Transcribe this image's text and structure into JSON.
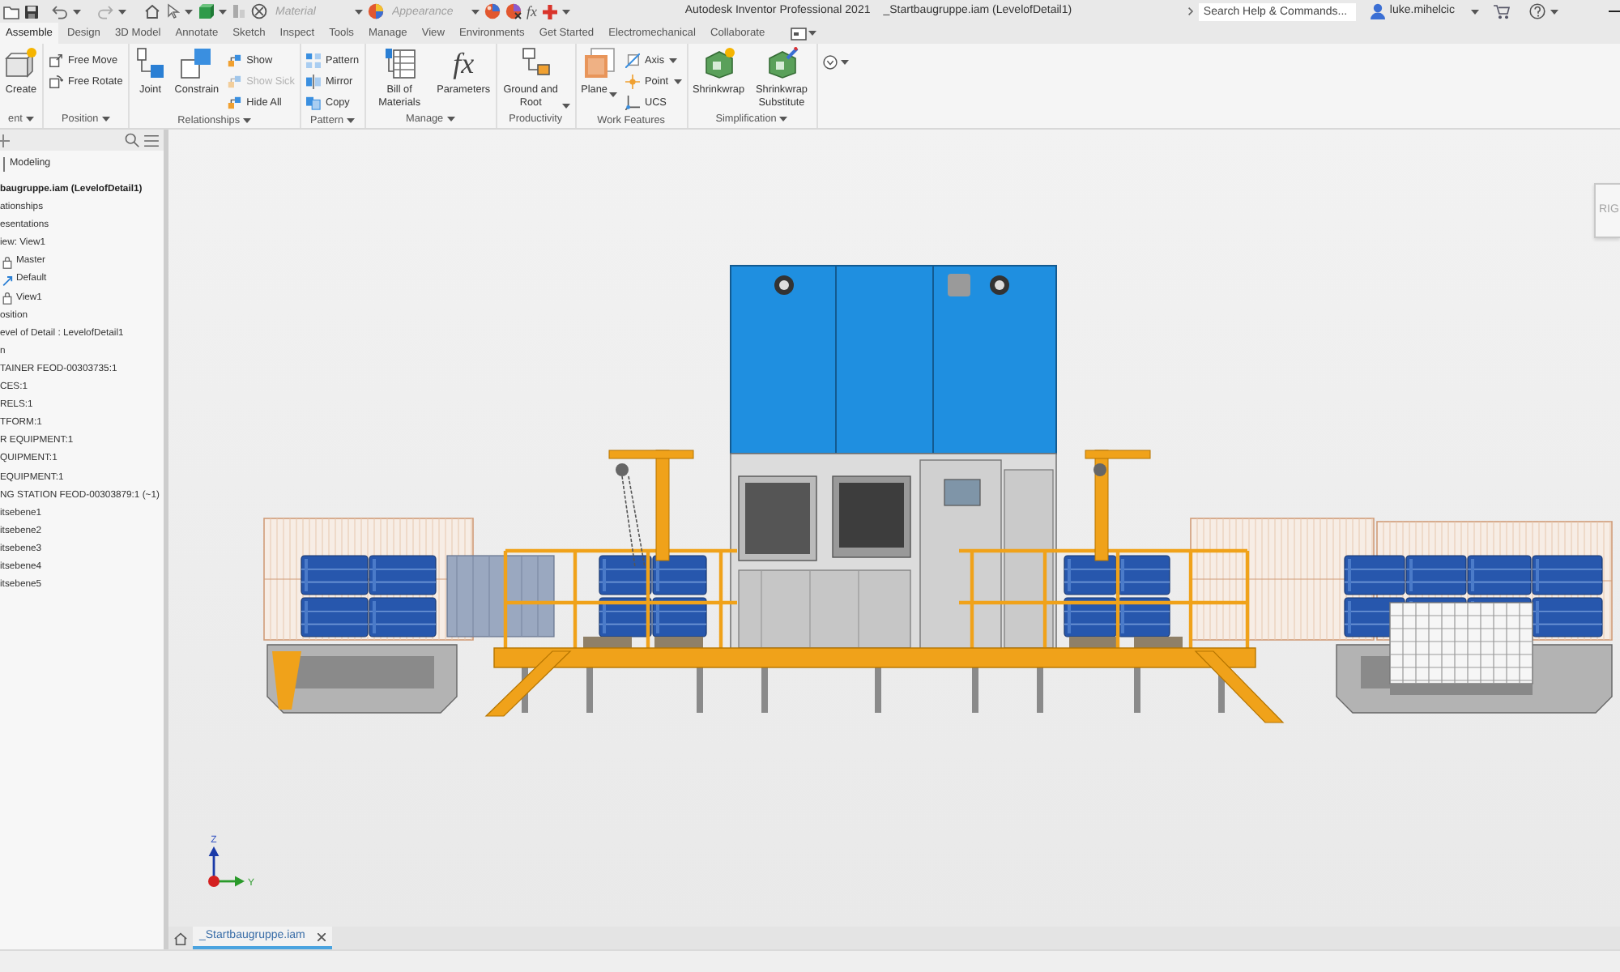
{
  "quick_access": {
    "material": {
      "placeholder": "Material"
    },
    "appearance": {
      "placeholder": "Appearance"
    },
    "formula_glyph": "fx"
  },
  "window": {
    "title": "Autodesk Inventor Professional 2021",
    "document": "_Startbaugruppe.iam (LevelofDetail1)"
  },
  "help_search": {
    "placeholder": "Search Help & Commands..."
  },
  "user": {
    "name": "luke.mihelcic"
  },
  "ribbon": {
    "tabs": [
      {
        "label": "Assemble",
        "selected": true
      },
      {
        "label": "Design",
        "selected": false
      },
      {
        "label": "3D Model",
        "selected": false
      },
      {
        "label": "Annotate",
        "selected": false
      },
      {
        "label": "Sketch",
        "selected": false
      },
      {
        "label": "Inspect",
        "selected": false
      },
      {
        "label": "Tools",
        "selected": false
      },
      {
        "label": "Manage",
        "selected": false
      },
      {
        "label": "View",
        "selected": false
      },
      {
        "label": "Environments",
        "selected": false
      },
      {
        "label": "Get Started",
        "selected": false
      },
      {
        "label": "Electromechanical",
        "selected": false
      },
      {
        "label": "Collaborate",
        "selected": false
      }
    ],
    "panels": [
      {
        "label": "ent",
        "menu": true,
        "tools": [
          {
            "kind": "large",
            "label": "Create",
            "dropdown": false,
            "disabled": false
          }
        ]
      },
      {
        "label": "Position",
        "menu": true,
        "tools": [
          {
            "kind": "small",
            "label": "Free Move",
            "dropdown": false,
            "disabled": false
          },
          {
            "kind": "small",
            "label": "Free Rotate",
            "dropdown": false,
            "disabled": false
          }
        ]
      },
      {
        "label": "Relationships",
        "menu": true,
        "tools": [
          {
            "kind": "large",
            "label": "Joint",
            "dropdown": false,
            "disabled": false
          },
          {
            "kind": "large",
            "label": "Constrain",
            "dropdown": false,
            "disabled": false
          },
          {
            "kind": "small",
            "label": "Show",
            "dropdown": false,
            "disabled": false
          },
          {
            "kind": "small",
            "label": "Show Sick",
            "dropdown": false,
            "disabled": true
          },
          {
            "kind": "small",
            "label": "Hide All",
            "dropdown": false,
            "disabled": false
          }
        ]
      },
      {
        "label": "Pattern",
        "menu": true,
        "tools": [
          {
            "kind": "small",
            "label": "Pattern",
            "dropdown": false,
            "disabled": false
          },
          {
            "kind": "small",
            "label": "Mirror",
            "dropdown": false,
            "disabled": false
          },
          {
            "kind": "small",
            "label": "Copy",
            "dropdown": false,
            "disabled": false
          }
        ]
      },
      {
        "label": "Manage",
        "menu": true,
        "tools": [
          {
            "kind": "large",
            "label": "Bill of Materials",
            "dropdown": false,
            "disabled": false
          },
          {
            "kind": "large",
            "label": "Parameters",
            "glyph": "fx",
            "dropdown": false,
            "disabled": false
          }
        ]
      },
      {
        "label": "Productivity",
        "menu": false,
        "tools": [
          {
            "kind": "large",
            "label": "Ground and Root",
            "dropdown": true,
            "disabled": false
          }
        ]
      },
      {
        "label": "Work Features",
        "menu": false,
        "tools": [
          {
            "kind": "large",
            "label": "Plane",
            "dropdown": true,
            "disabled": false
          },
          {
            "kind": "small",
            "label": "Axis",
            "dropdown": true,
            "disabled": false
          },
          {
            "kind": "small",
            "label": "Point",
            "dropdown": true,
            "disabled": false
          },
          {
            "kind": "small",
            "label": "UCS",
            "dropdown": false,
            "disabled": false
          }
        ]
      },
      {
        "label": "Simplification",
        "menu": true,
        "tools": [
          {
            "kind": "large",
            "label": "Shrinkwrap",
            "dropdown": false,
            "disabled": false
          },
          {
            "kind": "large",
            "label": "Shrinkwrap Substitute",
            "dropdown": false,
            "disabled": false
          }
        ]
      },
      {
        "tools": [
          {
            "kind": "icon",
            "dropdown": true,
            "disabled": false
          }
        ]
      }
    ]
  },
  "browser": {
    "mode_label": "Modeling",
    "tree": [
      {
        "label": "baugruppe.iam (LevelofDetail1)",
        "kind": "document"
      },
      {
        "label": "ationships",
        "kind": "node"
      },
      {
        "label": "esentations",
        "kind": "node"
      },
      {
        "label": "iew: View1",
        "kind": "node",
        "children": [
          {
            "label": "Master",
            "kind": "view",
            "locked": true
          },
          {
            "label": "Default",
            "kind": "view",
            "locked": false
          },
          {
            "label": "View1",
            "kind": "view",
            "locked": true
          }
        ]
      },
      {
        "label": "osition",
        "kind": "node"
      },
      {
        "label": "evel of Detail : LevelofDetail1",
        "kind": "node"
      },
      {
        "label": "n",
        "kind": "node"
      },
      {
        "label": "TAINER FEOD-00303735:1",
        "kind": "node"
      },
      {
        "label": "CES:1",
        "kind": "node"
      },
      {
        "label": "RELS:1",
        "kind": "node"
      },
      {
        "label": "TFORM:1",
        "kind": "node"
      },
      {
        "label": "R EQUIPMENT:1",
        "kind": "node"
      },
      {
        "label": "QUIPMENT:1",
        "kind": "node"
      },
      {
        "label": "EQUIPMENT:1",
        "kind": "node"
      },
      {
        "label": "NG STATION FEOD-00303879:1 (~1)",
        "kind": "node"
      },
      {
        "label": "itsebene1",
        "kind": "node"
      },
      {
        "label": "itsebene2",
        "kind": "node"
      },
      {
        "label": "itsebene3",
        "kind": "node"
      },
      {
        "label": "itsebene4",
        "kind": "node"
      },
      {
        "label": "itsebene5",
        "kind": "node"
      }
    ]
  },
  "viewport": {
    "view_cube": {
      "face_label": "RIG"
    },
    "triad": {
      "z_label": "Z",
      "y_label": "Y"
    }
  },
  "document_tabs": [
    {
      "label": "_Startbaugruppe.iam",
      "selected": true
    }
  ]
}
